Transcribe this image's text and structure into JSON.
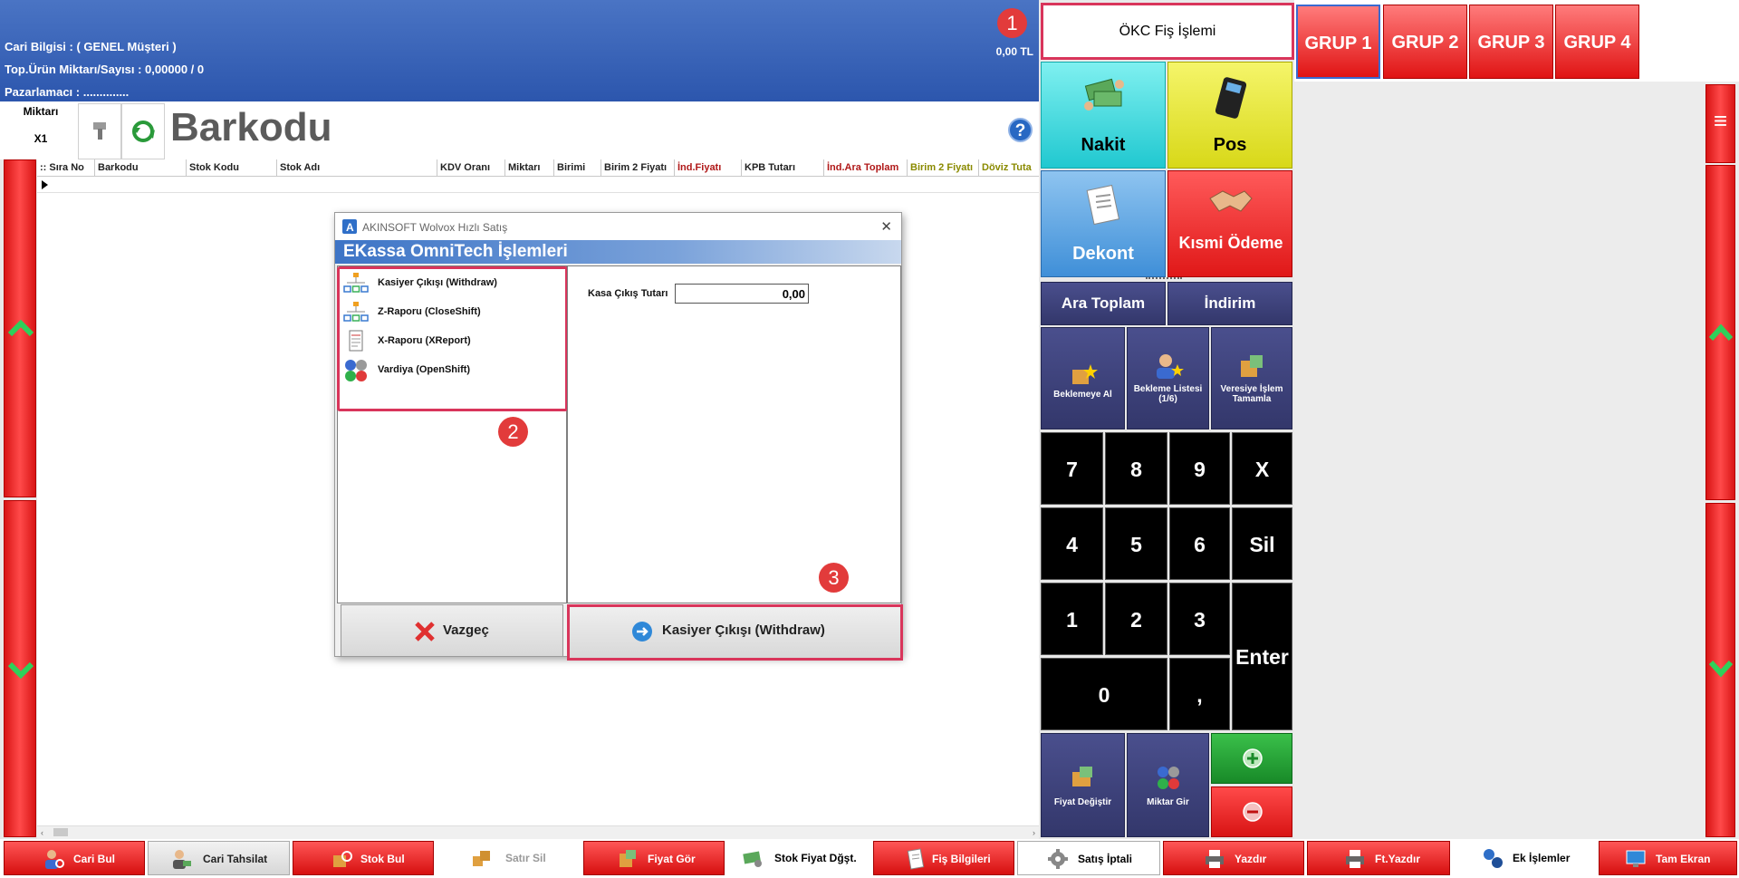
{
  "header": {
    "cari_bilgisi": "Cari Bilgisi : ( GENEL Müşteri )",
    "top_urun": "Top.Ürün Miktarı/Sayısı : 0,00000  /  0",
    "pazarlamaci": "Pazarlamacı : ..............",
    "total": "0,00 TL"
  },
  "quantity": {
    "label": "Miktarı",
    "value": "X1"
  },
  "barcode_label": "Barkodu",
  "help": "?",
  "grid": {
    "columns": [
      {
        "label": ":: Sıra No",
        "color": "#222222"
      },
      {
        "label": "Barkodu",
        "color": "#222222"
      },
      {
        "label": "Stok Kodu",
        "color": "#222222"
      },
      {
        "label": "Stok Adı",
        "color": "#222222"
      },
      {
        "label": "KDV Oranı",
        "color": "#222222"
      },
      {
        "label": "Miktarı",
        "color": "#222222"
      },
      {
        "label": "Birimi",
        "color": "#222222"
      },
      {
        "label": "Birim 2 Fiyatı",
        "color": "#222222"
      },
      {
        "label": "İnd.Fiyatı",
        "color": "#b01818"
      },
      {
        "label": "KPB Tutarı",
        "color": "#222222"
      },
      {
        "label": "İnd.Ara Toplam",
        "color": "#b01818"
      },
      {
        "label": "Birim 2 Fiyatı",
        "color": "#8a8a00"
      },
      {
        "label": "Döviz Tuta",
        "color": "#8a8a00"
      }
    ]
  },
  "dialog": {
    "window_title": "AKINSOFT Wolvox Hızlı Satış",
    "close": "✕",
    "header": "EKassa OmniTech İşlemleri",
    "menu_items": [
      {
        "label": "Kasiyer Çıkışı (Withdraw)",
        "icon": "hierarchy-icon"
      },
      {
        "label": "Z-Raporu (CloseShift)",
        "icon": "hierarchy-icon"
      },
      {
        "label": "X-Raporu (XReport)",
        "icon": "report-icon"
      },
      {
        "label": "Vardiya (OpenShift)",
        "icon": "balls-icon"
      }
    ],
    "field_label": "Kasa Çıkış Tutarı",
    "field_value": "0,00",
    "cancel_label": "Vazgeç",
    "confirm_label": "Kasiyer Çıkışı (Withdraw)"
  },
  "callouts": [
    "1",
    "2",
    "3"
  ],
  "right_panel": {
    "okc_label": "ÖKC Fiş İşlemi",
    "nakit": "Nakit",
    "pos": "Pos",
    "dekont": "Dekont",
    "kismi_odeme": "Kısmi Ödeme",
    "ara_toplam": "Ara Toplam",
    "indirim": "İndirim",
    "beklemeye_al": "Beklemeye Al",
    "bekleme_listesi": "Bekleme Listesi (1/6)",
    "veresiye": "Veresiye İşlem Tamamla",
    "keys": [
      "7",
      "8",
      "9",
      "X",
      "4",
      "5",
      "6",
      "Sil",
      "1",
      "2",
      "3",
      "Enter",
      "0",
      ","
    ],
    "fiyat_degistir": "Fiyat Değiştir",
    "miktar_gir": "Miktar Gir"
  },
  "groups": [
    "GRUP 1",
    "GRUP 2",
    "GRUP 3",
    "GRUP 4"
  ],
  "menu_icon": "≡",
  "bottom_bar": [
    {
      "label": "Cari Bul",
      "style": "red"
    },
    {
      "label": "Cari Tahsilat",
      "style": "gray"
    },
    {
      "label": "Stok Bul",
      "style": "red"
    },
    {
      "label": "Satır Sil",
      "style": "white-dim"
    },
    {
      "label": "Fiyat Gör",
      "style": "red"
    },
    {
      "label": "Stok Fiyat Dğşt.",
      "style": "white"
    },
    {
      "label": "Fiş Bilgileri",
      "style": "red"
    },
    {
      "label": "Satış İptali",
      "style": "white"
    },
    {
      "label": "Yazdır",
      "style": "red"
    },
    {
      "label": "Ft.Yazdır",
      "style": "red"
    },
    {
      "label": "Ek İşlemler",
      "style": "white"
    },
    {
      "label": "Tam Ekran",
      "style": "red"
    }
  ]
}
